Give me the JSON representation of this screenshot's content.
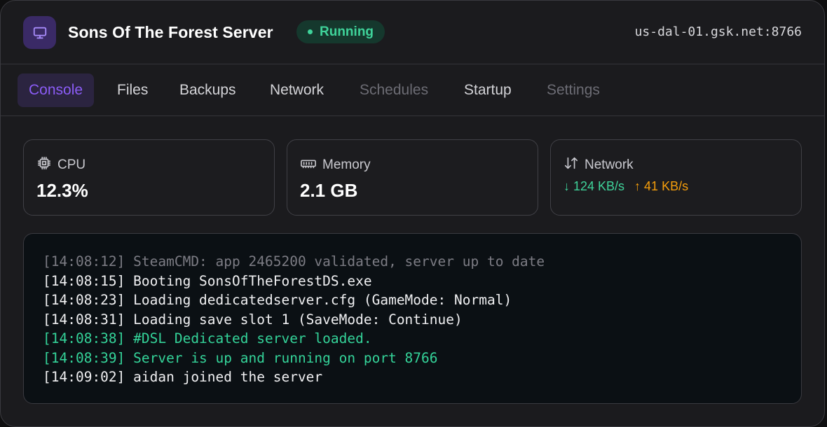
{
  "header": {
    "title": "Sons Of The Forest Server",
    "status": "Running",
    "host": "us-dal-01.gsk.net:8766",
    "app_icon": "monitor-icon"
  },
  "tabs": [
    {
      "label": "Console",
      "state": "active"
    },
    {
      "label": "Files",
      "state": "normal"
    },
    {
      "label": "Backups",
      "state": "normal"
    },
    {
      "label": "Network",
      "state": "normal"
    },
    {
      "label": "Schedules",
      "state": "disabled"
    },
    {
      "label": "Startup",
      "state": "normal"
    },
    {
      "label": "Settings",
      "state": "disabled"
    }
  ],
  "stats": {
    "cpu": {
      "label": "CPU",
      "value": "12.3%",
      "icon": "cpu-icon"
    },
    "memory": {
      "label": "Memory",
      "value": "2.1 GB",
      "icon": "memory-icon"
    },
    "network": {
      "label": "Network",
      "down": "↓ 124 KB/s",
      "up": "↑ 41 KB/s",
      "icon": "transfer-icon"
    }
  },
  "console": {
    "lines": [
      {
        "text": "[14:08:12] SteamCMD: app 2465200 validated, server up to date",
        "style": "dim"
      },
      {
        "text": "[14:08:15] Booting SonsOfTheForestDS.exe",
        "style": "normal"
      },
      {
        "text": "[14:08:23] Loading dedicatedserver.cfg (GameMode: Normal)",
        "style": "normal"
      },
      {
        "text": "[14:08:31] Loading save slot 1 (SaveMode: Continue)",
        "style": "normal"
      },
      {
        "text": "[14:08:38] #DSL Dedicated server loaded.",
        "style": "ok"
      },
      {
        "text": "[14:08:39] Server is up and running on port 8766",
        "style": "ok"
      },
      {
        "text": "[14:09:02] aidan joined the server",
        "style": "normal"
      }
    ]
  },
  "colors": {
    "accent": "#8b5cf6",
    "success": "#3fd39a",
    "warning": "#f59e0b",
    "background": "#1b1b1e"
  }
}
